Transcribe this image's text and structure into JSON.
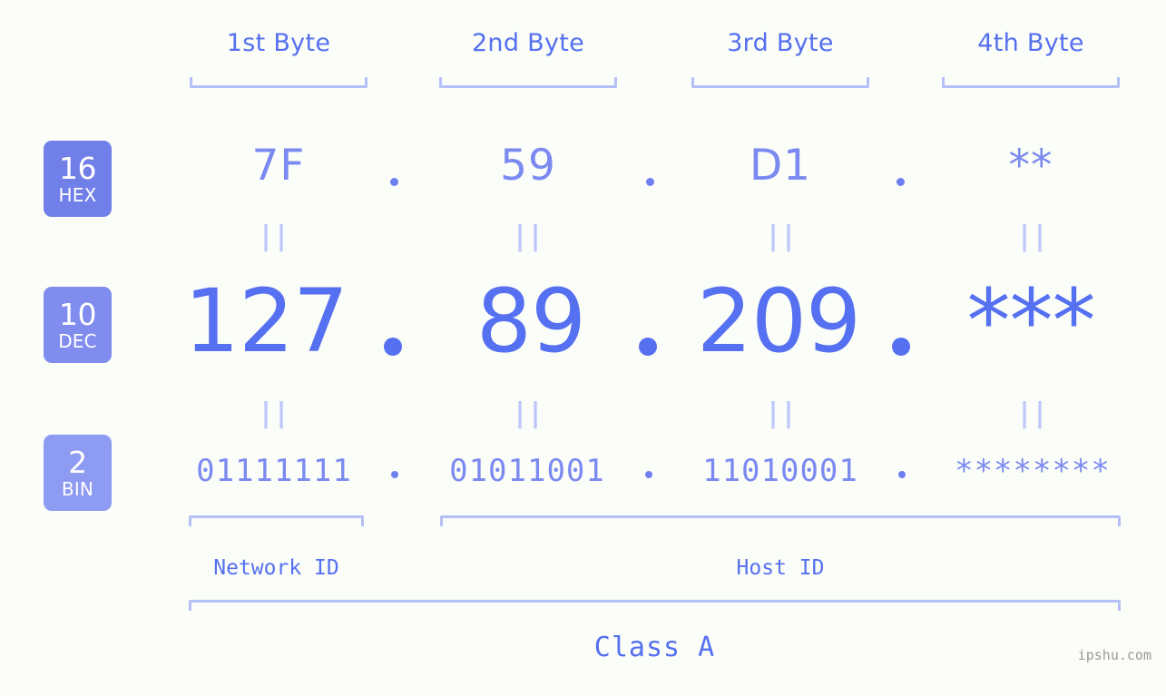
{
  "background_color": "#fbfdf8",
  "accent_color": "#5570f0",
  "muted_accent_color": "#7b8af0",
  "bracket_color": "#b5c0f8",
  "byte_headers": [
    {
      "label": "1st Byte"
    },
    {
      "label": "2nd Byte"
    },
    {
      "label": "3rd Byte"
    },
    {
      "label": "4th Byte"
    }
  ],
  "bases": [
    {
      "number": "16",
      "abbr": "HEX",
      "color": "#717fe8"
    },
    {
      "number": "10",
      "abbr": "DEC",
      "color": "#808cee"
    },
    {
      "number": "2",
      "abbr": "BIN",
      "color": "#8e9bf2"
    }
  ],
  "rows": {
    "hex": {
      "values": [
        "7F",
        "59",
        "D1",
        "**"
      ],
      "separator": "."
    },
    "dec": {
      "values": [
        "127",
        "89",
        "209",
        "***"
      ],
      "separator": "."
    },
    "bin": {
      "values": [
        "01111111",
        "01011001",
        "11010001",
        "********"
      ],
      "separator": "."
    }
  },
  "equals_symbol": "||",
  "segments": {
    "network_id": "Network ID",
    "host_id": "Host ID",
    "class": "Class A"
  },
  "watermark": "ipshu.com"
}
